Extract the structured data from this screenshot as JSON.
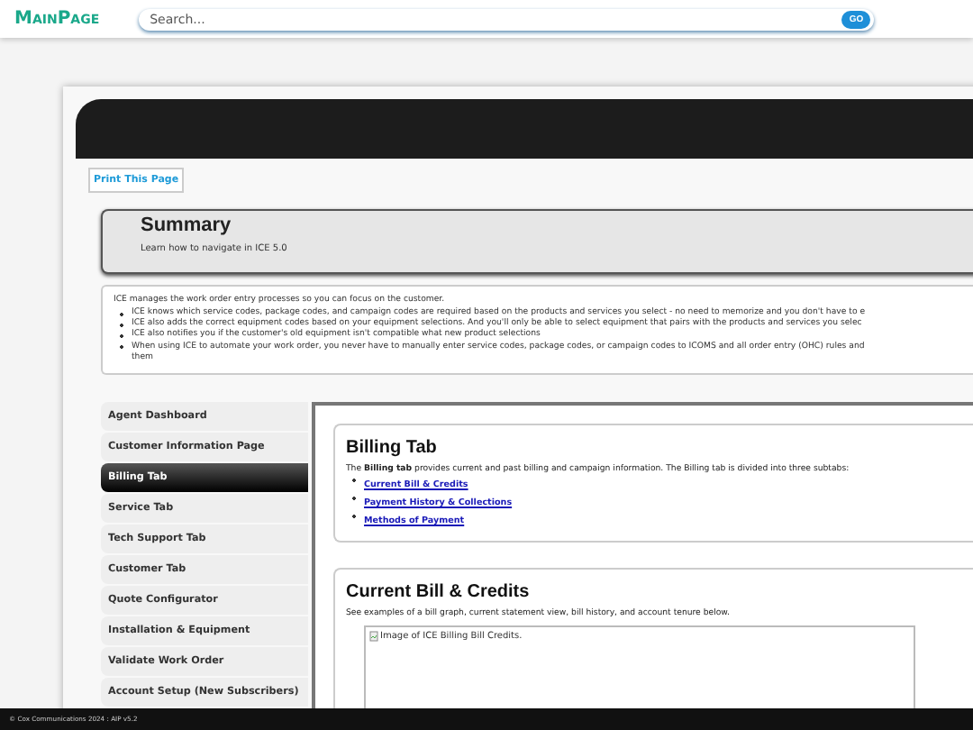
{
  "header": {
    "logo": "MainPage",
    "search": {
      "placeholder": "Search..."
    },
    "go_button": "GO"
  },
  "print_button": "Print This Page",
  "summary": {
    "title": "Summary",
    "subtitle": "Learn how to navigate in ICE 5.0"
  },
  "intro": {
    "text": "ICE manages the work order entry processes so you can focus on the customer.",
    "bullets": [
      {
        "lines": [
          "ICE knows which service codes, package codes, and campaign codes are required based on the products and services you select - no need to memorize and you don't have to e"
        ]
      },
      {
        "lines": [
          "ICE also adds the correct equipment codes based on your equipment selections. And you'll only be able to select equipment that pairs with the products and services you selec"
        ]
      },
      {
        "lines": [
          "ICE also notifies you if the customer's old equipment isn't compatible what new product selections"
        ]
      },
      {
        "lines": [
          "When using ICE to automate your work order, you never have to manually enter service codes, package codes, or campaign codes to ICOMS and all order entry (OHC) rules and",
          "them"
        ]
      }
    ]
  },
  "sidebar": {
    "items": [
      {
        "label": "Agent Dashboard",
        "selected": false
      },
      {
        "label": "Customer Information Page",
        "selected": false
      },
      {
        "label": "Billing Tab",
        "selected": true
      },
      {
        "label": "Service Tab",
        "selected": false
      },
      {
        "label": "Tech Support Tab",
        "selected": false
      },
      {
        "label": "Customer Tab",
        "selected": false
      },
      {
        "label": "Quote Configurator",
        "selected": false
      },
      {
        "label": "Installation & Equipment",
        "selected": false
      },
      {
        "label": "Validate Work Order",
        "selected": false
      },
      {
        "label": "Account Setup (New Subscribers)",
        "selected": false
      }
    ]
  },
  "billing": {
    "title": "Billing Tab",
    "description": "The **Billing tab** provides current and past billing and campaign information. The Billing tab is divided into three subtabs:",
    "links": [
      "Current Bill & Credits",
      "Payment History & Collections",
      "Methods of Payment"
    ]
  },
  "current_bill": {
    "title": "Current Bill & Credits",
    "description": "See examples of a bill graph, current statement view, bill history, and account tenure below.",
    "image_alt": "Image of ICE Billing Bill Credits."
  },
  "footer": "© Cox Communications 2024 : AIP v5.2"
}
